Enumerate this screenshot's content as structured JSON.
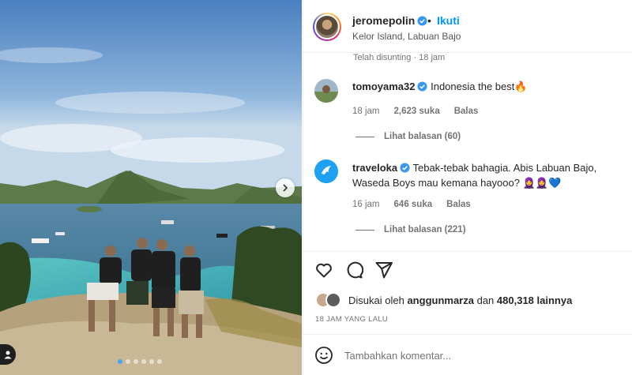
{
  "post": {
    "username": "jeromepolin",
    "separator": "•",
    "follow_label": "Ikuti",
    "location": "Kelor Island, Labuan Bajo"
  },
  "caption_meta": {
    "edited_label": "Telah disunting · 18 jam"
  },
  "comments": [
    {
      "username": "tomoyama32",
      "verified": true,
      "text": "Indonesia the best🔥",
      "time": "18 jam",
      "likes": "2,623 suka",
      "reply_label": "Balas",
      "view_replies": "Lihat balasan (60)"
    },
    {
      "username": "traveloka",
      "verified": true,
      "text": "Tebak-tebak bahagia. Abis Labuan Bajo, Waseda Boys mau kemana hayooo? 🧕🧕💙",
      "time": "16 jam",
      "likes": "646 suka",
      "reply_label": "Balas",
      "view_replies": "Lihat balasan (221)"
    }
  ],
  "actions": {
    "like_icon": "heart-icon",
    "comment_icon": "comment-bubble-icon",
    "share_icon": "send-paper-plane-icon"
  },
  "likes": {
    "prefix": "Disukai oleh",
    "user": "anggunmarza",
    "middle": "dan",
    "count": "480,318 lainnya"
  },
  "timestamp": "18 JAM YANG LALU",
  "add_comment": {
    "placeholder": "Tambahkan komentar...",
    "emoji_icon": "smiley-icon"
  },
  "carousel": {
    "slides": 6,
    "active_index": 0,
    "next_icon": "chevron-right-icon"
  },
  "colors": {
    "accent": "#0095f6",
    "verified": "#3897f0",
    "text": "#262626",
    "muted": "#737373"
  }
}
